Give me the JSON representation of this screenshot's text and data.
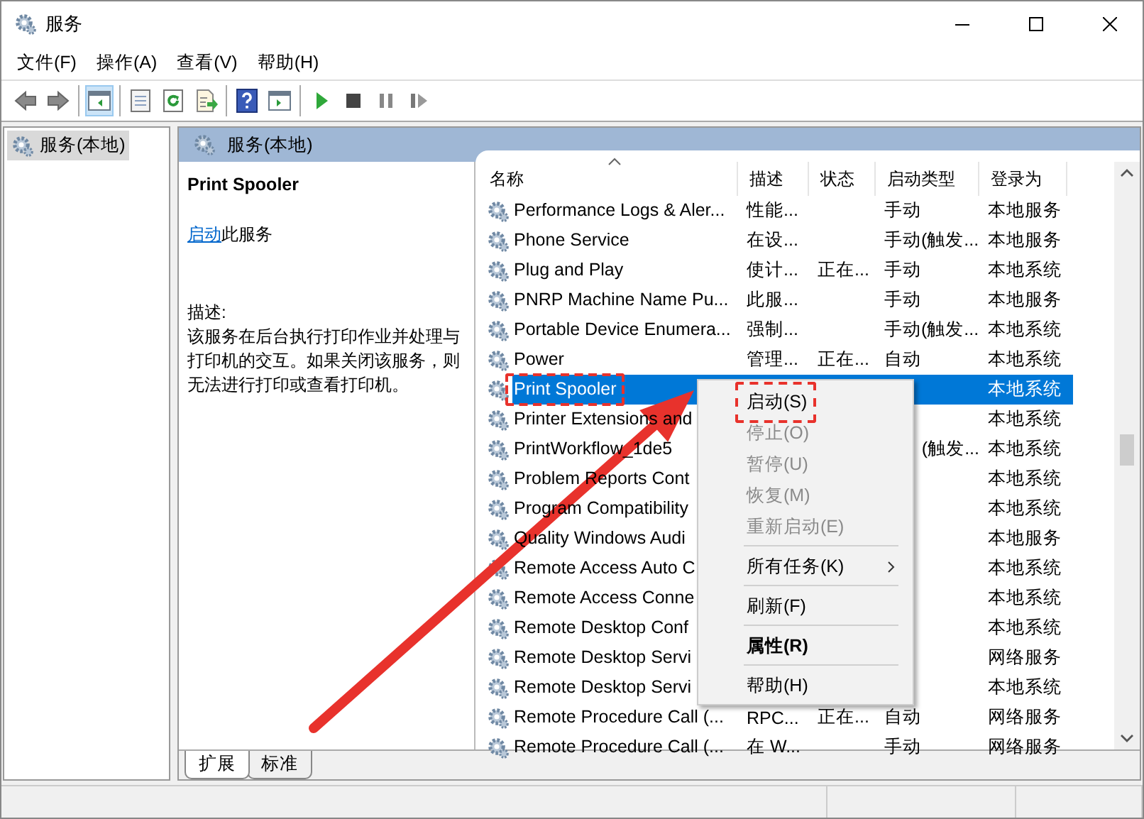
{
  "window": {
    "title": "服务"
  },
  "menu_bar": [
    "文件(F)",
    "操作(A)",
    "查看(V)",
    "帮助(H)"
  ],
  "toolbar": {
    "groups": [
      {
        "buttons": [
          {
            "kind": "back",
            "pressed": false
          },
          {
            "kind": "forward",
            "pressed": false
          }
        ]
      },
      {
        "buttons": [
          {
            "kind": "tree-toggle",
            "pressed": true
          }
        ]
      },
      {
        "buttons": [
          {
            "kind": "properties",
            "pressed": false
          },
          {
            "kind": "refresh",
            "pressed": false
          },
          {
            "kind": "export",
            "pressed": false
          }
        ]
      },
      {
        "buttons": [
          {
            "kind": "help",
            "pressed": false
          },
          {
            "kind": "action-pane",
            "pressed": false
          }
        ]
      },
      {
        "buttons": [
          {
            "kind": "start",
            "pressed": false
          },
          {
            "kind": "stop",
            "pressed": false
          },
          {
            "kind": "pause",
            "pressed": false
          },
          {
            "kind": "resume",
            "pressed": false
          }
        ]
      }
    ]
  },
  "tree": {
    "items": [
      {
        "label": "服务(本地)",
        "selected": true
      }
    ]
  },
  "pane_header": {
    "title": "服务(本地)"
  },
  "details": {
    "title": "Print Spooler",
    "action_link": "启动",
    "action_text": "此服务",
    "description_label": "描述:",
    "description": "该服务在后台执行打印作业并处理与打印机的交互。如果关闭该服务，则无法进行打印或查看打印机。"
  },
  "services": {
    "columns": [
      {
        "label": "名称",
        "sorted": true
      },
      {
        "label": "描述",
        "sorted": false
      },
      {
        "label": "状态",
        "sorted": false
      },
      {
        "label": "启动类型",
        "sorted": false
      },
      {
        "label": "登录为",
        "sorted": false
      }
    ],
    "rows": [
      {
        "name": "Performance Logs & Aler...",
        "description": "性能...",
        "startup_type": "手动",
        "log_on_as": "本地服务",
        "selected": false,
        "highlighted": false
      },
      {
        "name": "Phone Service",
        "description": "在设...",
        "startup_type": "手动(触发...",
        "log_on_as": "本地服务",
        "selected": false,
        "highlighted": false
      },
      {
        "name": "Plug and Play",
        "description": "使计...",
        "status": "正在...",
        "startup_type": "手动",
        "log_on_as": "本地系统",
        "selected": false,
        "highlighted": false
      },
      {
        "name": "PNRP Machine Name Pu...",
        "description": "此服...",
        "startup_type": "手动",
        "log_on_as": "本地服务",
        "selected": false,
        "highlighted": false
      },
      {
        "name": "Portable Device Enumera...",
        "description": "强制...",
        "startup_type": "手动(触发...",
        "log_on_as": "本地系统",
        "selected": false,
        "highlighted": false
      },
      {
        "name": "Power",
        "description": "管理...",
        "status": "正在...",
        "startup_type": "自动",
        "log_on_as": "本地系统",
        "selected": false,
        "highlighted": false
      },
      {
        "name": "Print Spooler",
        "log_on_as": "本地系统",
        "selected": true,
        "highlighted": true
      },
      {
        "name": "Printer Extensions and",
        "log_on_as": "本地系统",
        "selected": false,
        "highlighted": false
      },
      {
        "name": "PrintWorkflow_1de5",
        "startup_type": "(触发...",
        "log_on_as": "本地系统",
        "selected": false,
        "highlighted": false
      },
      {
        "name": "Problem Reports Cont",
        "log_on_as": "本地系统",
        "selected": false,
        "highlighted": false
      },
      {
        "name": "Program Compatibility",
        "log_on_as": "本地系统",
        "selected": false,
        "highlighted": false
      },
      {
        "name": "Quality Windows Audi",
        "log_on_as": "本地服务",
        "selected": false,
        "highlighted": false
      },
      {
        "name": "Remote Access Auto C",
        "log_on_as": "本地系统",
        "selected": false,
        "highlighted": false
      },
      {
        "name": "Remote Access Conne",
        "log_on_as": "本地系统",
        "selected": false,
        "highlighted": false
      },
      {
        "name": "Remote Desktop Conf",
        "log_on_as": "本地系统",
        "selected": false,
        "highlighted": false
      },
      {
        "name": "Remote Desktop Servi",
        "log_on_as": "网络服务",
        "selected": false,
        "highlighted": false
      },
      {
        "name": "Remote Desktop Servi",
        "log_on_as": "本地系统",
        "selected": false,
        "highlighted": false
      },
      {
        "name": "Remote Procedure Call (...",
        "description": "RPC...",
        "status": "正在...",
        "startup_type": "自动",
        "log_on_as": "网络服务",
        "selected": false,
        "highlighted": false
      },
      {
        "name": "Remote Procedure Call (...",
        "description": "在 W...",
        "startup_type": "手动",
        "log_on_as": "网络服务",
        "selected": false,
        "highlighted": false
      }
    ]
  },
  "context_menu": {
    "items": [
      {
        "kind": "item",
        "label": "启动(S)",
        "disabled": false,
        "highlighted": true,
        "default": false,
        "submenu": false
      },
      {
        "kind": "item",
        "label": "停止(O)",
        "disabled": true,
        "highlighted": false,
        "default": false,
        "submenu": false
      },
      {
        "kind": "item",
        "label": "暂停(U)",
        "disabled": true,
        "highlighted": false,
        "default": false,
        "submenu": false
      },
      {
        "kind": "item",
        "label": "恢复(M)",
        "disabled": true,
        "highlighted": false,
        "default": false,
        "submenu": false
      },
      {
        "kind": "item",
        "label": "重新启动(E)",
        "disabled": true,
        "highlighted": false,
        "default": false,
        "submenu": false
      },
      {
        "kind": "separator"
      },
      {
        "kind": "item",
        "label": "所有任务(K)",
        "disabled": false,
        "highlighted": false,
        "default": false,
        "submenu": true
      },
      {
        "kind": "separator"
      },
      {
        "kind": "item",
        "label": "刷新(F)",
        "disabled": false,
        "highlighted": false,
        "default": false,
        "submenu": false
      },
      {
        "kind": "separator"
      },
      {
        "kind": "item",
        "label": "属性(R)",
        "disabled": false,
        "highlighted": false,
        "default": true,
        "submenu": false
      },
      {
        "kind": "separator"
      },
      {
        "kind": "item",
        "label": "帮助(H)",
        "disabled": false,
        "highlighted": false,
        "default": false,
        "submenu": false
      }
    ]
  },
  "bottom_tabs": [
    {
      "label": "扩展",
      "selected": true
    },
    {
      "label": "标准",
      "selected": false
    }
  ],
  "annotation": {
    "arrow": true
  }
}
